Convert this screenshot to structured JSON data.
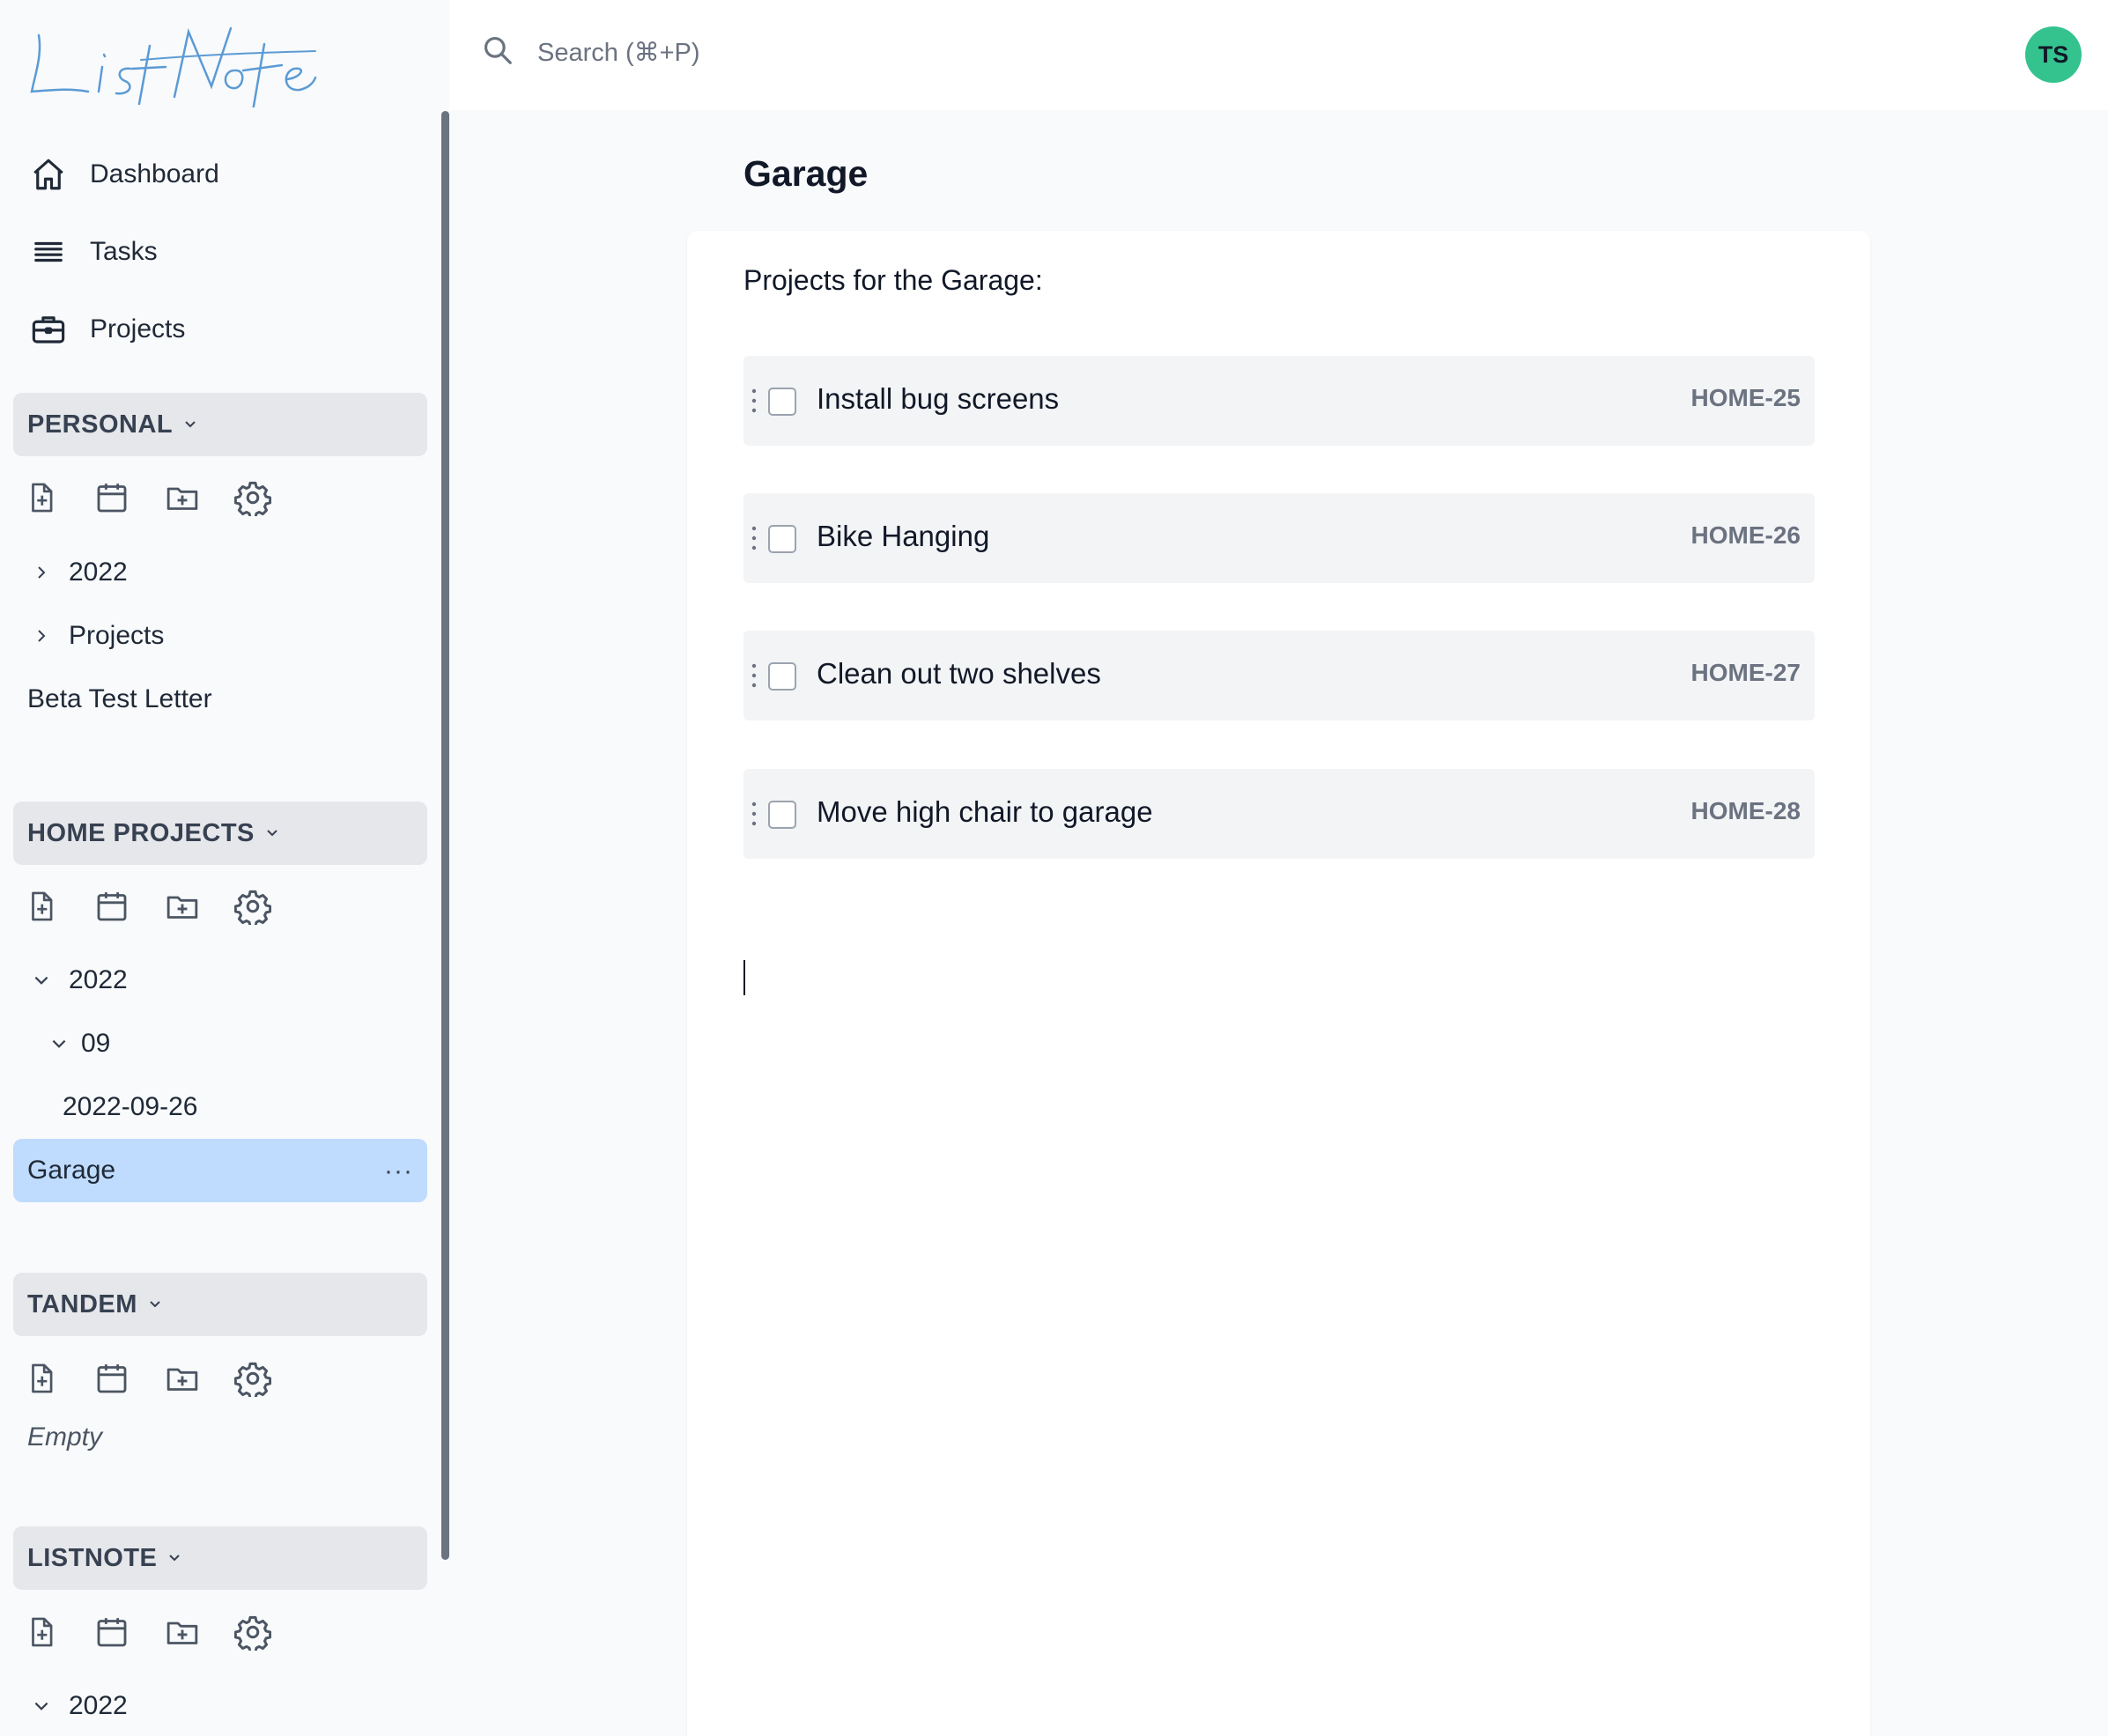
{
  "app": {
    "logo_text": "ListNote"
  },
  "search": {
    "placeholder": "Search (⌘+P)"
  },
  "user": {
    "initials": "TS",
    "avatar_color": "#34c38f"
  },
  "nav": [
    {
      "label": "Dashboard",
      "icon": "home-icon"
    },
    {
      "label": "Tasks",
      "icon": "list-icon"
    },
    {
      "label": "Projects",
      "icon": "briefcase-icon"
    }
  ],
  "sections": {
    "personal": {
      "label": "PERSONAL",
      "items": [
        {
          "label": "2022",
          "expanded": false
        },
        {
          "label": "Projects",
          "expanded": false
        },
        {
          "label": "Beta Test Letter"
        }
      ]
    },
    "home_projects": {
      "label": "HOME PROJECTS",
      "items": [
        {
          "label": "2022",
          "expanded": true
        },
        {
          "label": "09",
          "expanded": true
        },
        {
          "label": "2022-09-26"
        },
        {
          "label": "Garage",
          "selected": true,
          "more": "···"
        }
      ]
    },
    "tandem": {
      "label": "TANDEM",
      "empty_label": "Empty"
    },
    "listnote": {
      "label": "LISTNOTE",
      "items": [
        {
          "label": "2022",
          "expanded": true
        }
      ]
    }
  },
  "page": {
    "title": "Garage",
    "intro": "Projects for the Garage:",
    "tasks": [
      {
        "title": "Install bug screens",
        "id": "HOME-25",
        "done": false
      },
      {
        "title": "Bike Hanging",
        "id": "HOME-26",
        "done": false
      },
      {
        "title": "Clean out two shelves",
        "id": "HOME-27",
        "done": false
      },
      {
        "title": "Move high chair to garage",
        "id": "HOME-28",
        "done": false
      }
    ]
  },
  "colors": {
    "selected_bg": "#bfdbfe",
    "section_bg": "#e5e7eb",
    "task_bg": "#f3f4f6",
    "logo_color": "#5b9bd5"
  }
}
